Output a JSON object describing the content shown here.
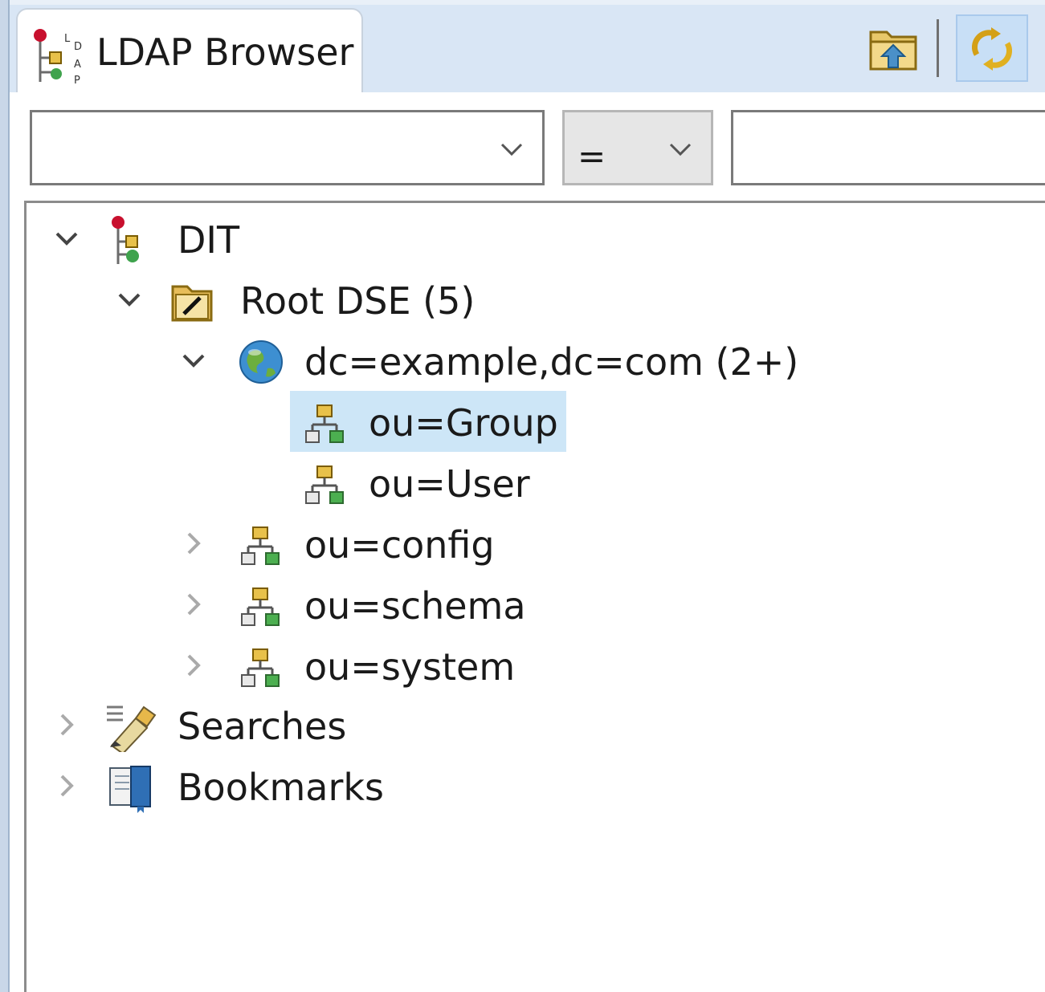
{
  "view": {
    "tab_title": "LDAP Browser",
    "tab_icon": "ldap-browser-icon",
    "toolbar": [
      {
        "name": "up-one-level",
        "icon": "folder-up-icon"
      },
      {
        "name": "link-with-editor",
        "icon": "sync-link-icon",
        "pressed": true
      }
    ]
  },
  "filter": {
    "attribute_value": "",
    "operator": "=",
    "value": ""
  },
  "tree": {
    "dit": {
      "label": "DIT",
      "icon": "dit-icon",
      "expanded": true
    },
    "root_dse": {
      "label": "Root DSE (5)",
      "icon": "root-dse-folder-icon",
      "expanded": true
    },
    "dc_example": {
      "label": "dc=example,dc=com (2+)",
      "icon": "globe-icon",
      "expanded": true
    },
    "ou_group": {
      "label": "ou=Group",
      "icon": "ou-entry-icon",
      "selected": true
    },
    "ou_user": {
      "label": "ou=User",
      "icon": "ou-entry-icon"
    },
    "ou_config": {
      "label": "ou=config",
      "icon": "ou-entry-icon",
      "expanded": false
    },
    "ou_schema": {
      "label": "ou=schema",
      "icon": "ou-entry-icon",
      "expanded": false
    },
    "ou_system": {
      "label": "ou=system",
      "icon": "ou-entry-icon",
      "expanded": false
    },
    "searches": {
      "label": "Searches",
      "icon": "searches-icon",
      "expanded": false
    },
    "bookmarks": {
      "label": "Bookmarks",
      "icon": "bookmarks-icon",
      "expanded": false
    }
  },
  "colors": {
    "tabbar_bg": "#d9e6f5",
    "selection_bg": "#cde6f7",
    "pressed_button_bg": "#c8dff6"
  }
}
